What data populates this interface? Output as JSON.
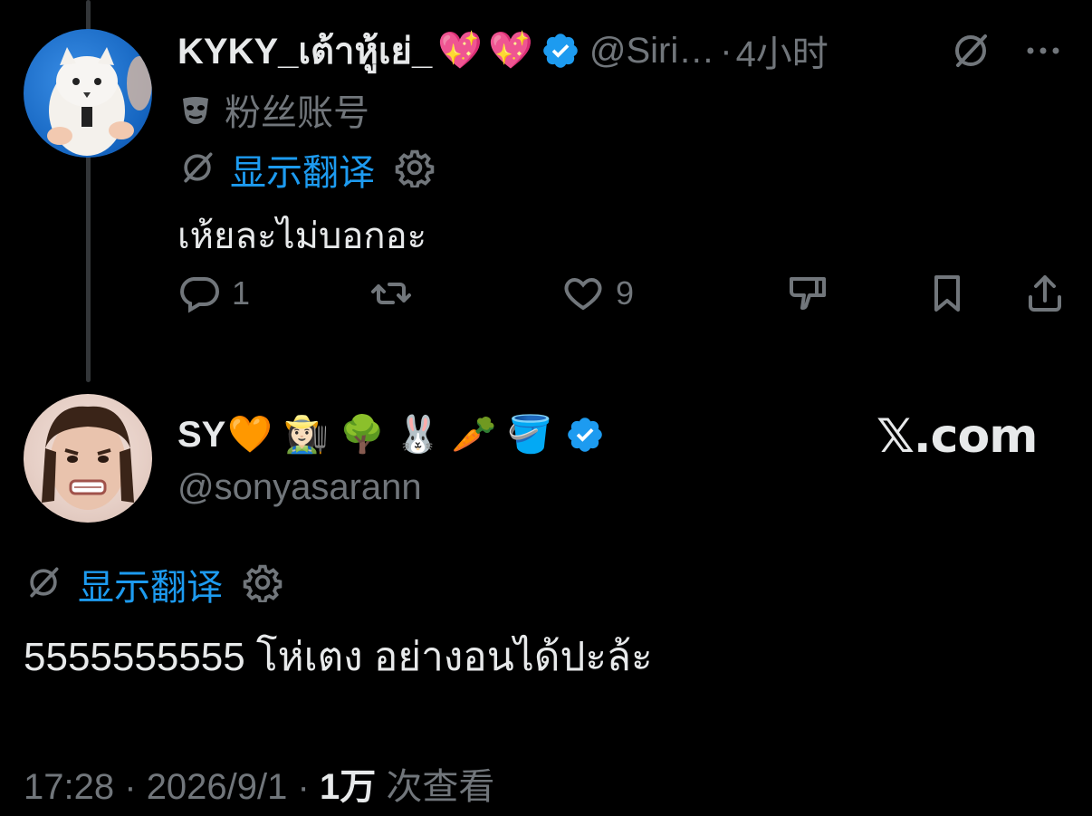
{
  "tweet1": {
    "display_name": "KYKY_เต้าหู้เย่_",
    "name_emojis": [
      "💖",
      "💖"
    ],
    "handle": "@Siri…",
    "separator": "·",
    "time": "4小时",
    "account_badge_label": "粉丝账号",
    "show_translation": "显示翻译",
    "text": "เห้ยละไม่บอกอะ",
    "replies": "1",
    "likes": "9"
  },
  "tweet2": {
    "display_name": "SY",
    "name_emojis": [
      "🧡",
      "👩🏻‍🌾",
      "🌳",
      "🐰",
      "🥕",
      "🪣"
    ],
    "handle": "@sonyasarann",
    "show_translation": "显示翻译",
    "text": "5555555555 โห่เตง อย่างอนได้ปะล้ะ",
    "footer_time": "17:28",
    "footer_sep1": "·",
    "footer_date": "2026/9/1",
    "footer_sep2": "·",
    "views_count": "1万",
    "views_label": "次查看"
  },
  "watermark": "𝕏.com",
  "colors": {
    "background": "#000000",
    "text_primary": "#e7e9ea",
    "text_secondary": "#71767b",
    "accent_blue": "#1d9bf0"
  }
}
